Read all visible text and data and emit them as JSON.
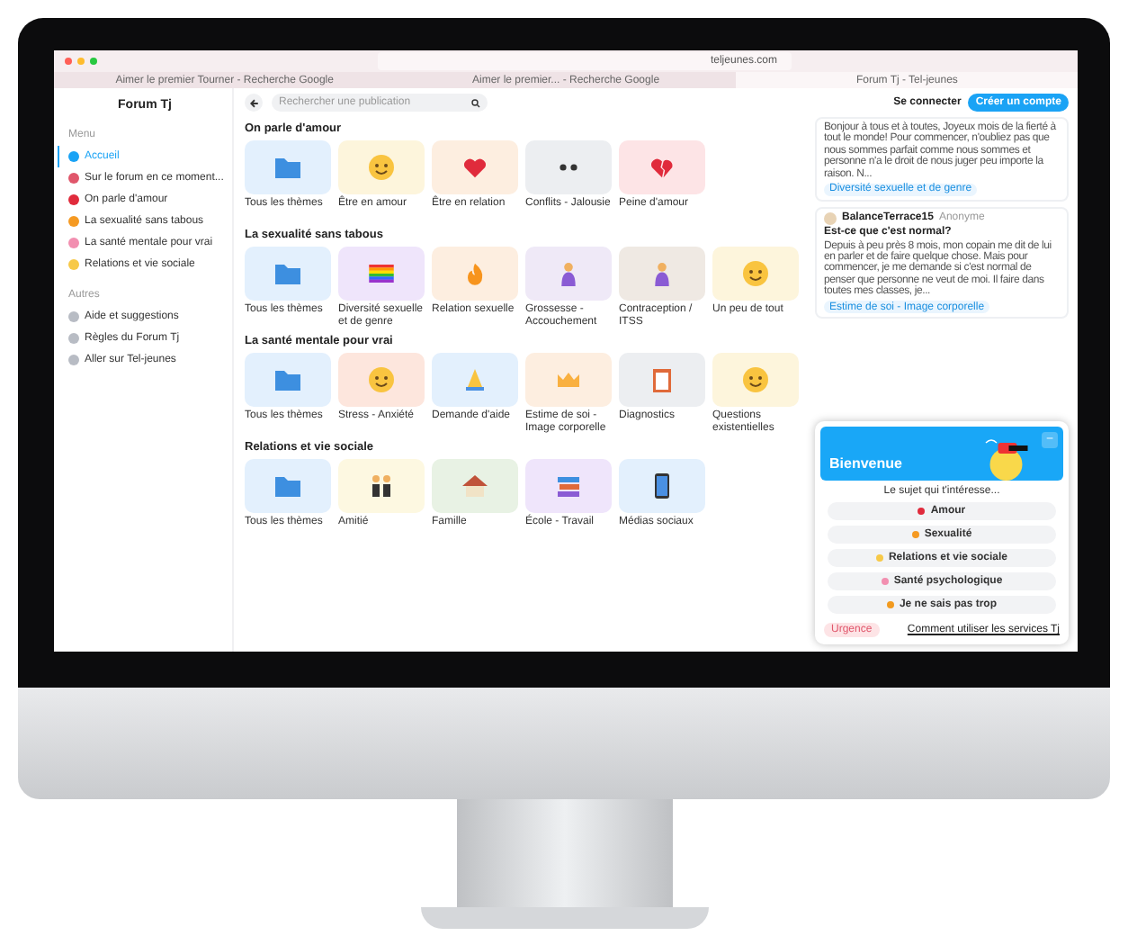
{
  "browser": {
    "address": "teljeunes.com",
    "tabs": [
      {
        "label": "Aimer le premier Tourner - Recherche Google",
        "selected": false
      },
      {
        "label": "Aimer le premier... - Recherche Google",
        "selected": false
      },
      {
        "label": "Forum Tj - Tel-jeunes",
        "selected": true
      }
    ]
  },
  "sidebar": {
    "title": "Forum Tj",
    "groups": [
      {
        "heading": "Menu",
        "items": [
          {
            "label": "Accueil",
            "selected": true,
            "color": "#1aa3f5"
          },
          {
            "label": "Sur le forum en ce moment...",
            "selected": false,
            "color": "#e0566b"
          },
          {
            "label": "On parle d'amour",
            "selected": false,
            "color": "#e02b3c"
          },
          {
            "label": "La sexualité sans tabous",
            "selected": false,
            "color": "#f59a23"
          },
          {
            "label": "La santé mentale pour vrai",
            "selected": false,
            "color": "#f28fb0"
          },
          {
            "label": "Relations et vie sociale",
            "selected": false,
            "color": "#f7c948"
          }
        ]
      },
      {
        "heading": "Autres",
        "items": [
          {
            "label": "Aide et suggestions",
            "selected": false,
            "color": "#b8bcc4"
          },
          {
            "label": "Règles du Forum Tj",
            "selected": false,
            "color": "#b8bcc4"
          },
          {
            "label": "Aller sur Tel-jeunes",
            "selected": false,
            "color": "#b8bcc4"
          }
        ]
      }
    ]
  },
  "search": {
    "placeholder": "Rechercher une publication"
  },
  "sections": [
    {
      "title": "On parle d'amour",
      "cards": [
        {
          "label": "Tous les thèmes",
          "color": "#e3f0fd"
        },
        {
          "label": "Être en amour",
          "color": "#fdf5dc"
        },
        {
          "label": "Être en relation",
          "color": "#fdeee0"
        },
        {
          "label": "Conflits - Jalousie",
          "color": "#eceef1"
        },
        {
          "label": "Peine d'amour",
          "color": "#fde4e6"
        }
      ]
    },
    {
      "title": "La sexualité sans tabous",
      "cards": [
        {
          "label": "Tous les thèmes",
          "color": "#e3f0fd"
        },
        {
          "label": "Diversité sexuelle et de genre",
          "color": "#efe5fb"
        },
        {
          "label": "Relation sexuelle",
          "color": "#fdeee0"
        },
        {
          "label": "Grossesse - Accouchement",
          "color": "#efe9f7"
        },
        {
          "label": "Contraception / ITSS",
          "color": "#efe9e3"
        },
        {
          "label": "Un peu de tout",
          "color": "#fdf5dc"
        }
      ]
    },
    {
      "title": "La santé mentale pour vrai",
      "cards": [
        {
          "label": "Tous les thèmes",
          "color": "#e3f0fd"
        },
        {
          "label": "Stress - Anxiété",
          "color": "#fde6dd"
        },
        {
          "label": "Demande d'aide",
          "color": "#e3f0fd"
        },
        {
          "label": "Estime de soi - Image corporelle",
          "color": "#fdeee0"
        },
        {
          "label": "Diagnostics",
          "color": "#eceef1"
        },
        {
          "label": "Questions existentielles",
          "color": "#fdf5dc"
        }
      ]
    },
    {
      "title": "Relations et vie sociale",
      "cards": [
        {
          "label": "Tous les thèmes",
          "color": "#e3f0fd"
        },
        {
          "label": "Amitié",
          "color": "#fdf8e1"
        },
        {
          "label": "Famille",
          "color": "#e8f2e4"
        },
        {
          "label": "École - Travail",
          "color": "#efe5fb"
        },
        {
          "label": "Médias sociaux",
          "color": "#e3f0fd"
        }
      ]
    }
  ],
  "account": {
    "login": "Se connecter",
    "signup": "Créer un compte"
  },
  "posts": [
    {
      "body": "Bonjour à tous et à toutes, Joyeux mois de la fierté à tout le monde! Pour commencer, n'oubliez pas que nous sommes parfait comme nous sommes et personne n'a le droit de nous juger peu importe la raison. N...",
      "tag": "Diversité sexuelle et de genre"
    },
    {
      "author": "BalanceTerrace15",
      "meta": "Anonyme",
      "title": "Est-ce que c'est normal?",
      "body": "Depuis à peu près 8 mois, mon copain me dit de lui en parler et de faire quelque chose. Mais pour commencer, je me demande si c'est normal de penser que personne ne veut de moi. Il faire dans toutes mes classes, je...",
      "tag": "Estime de soi - Image corporelle"
    }
  ],
  "welcome": {
    "title": "Bienvenue",
    "minimize": "–",
    "prompt": "Le sujet qui t'intéresse...",
    "options": [
      {
        "label": "Amour",
        "color": "#e02b3c"
      },
      {
        "label": "Sexualité",
        "color": "#f59a23"
      },
      {
        "label": "Relations et vie sociale",
        "color": "#f7c948"
      },
      {
        "label": "Santé psychologique",
        "color": "#f28fb0"
      },
      {
        "label": "Je ne sais pas trop",
        "color": "#f29a1f"
      }
    ],
    "urgent": "Urgence",
    "help_link": "Comment utiliser les services Tj"
  }
}
